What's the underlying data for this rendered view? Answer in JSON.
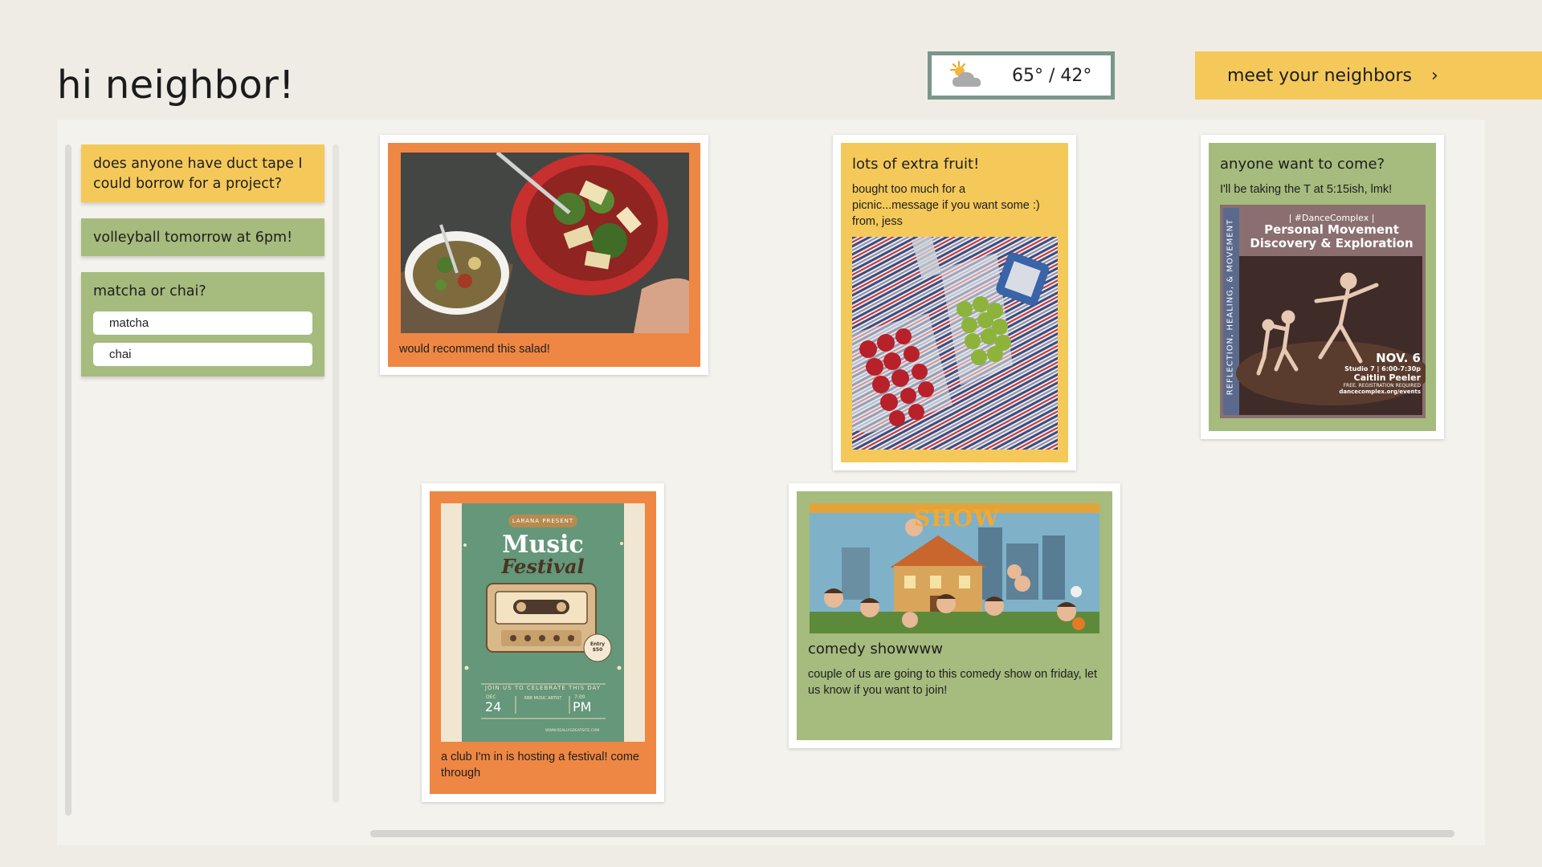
{
  "header": {
    "title": "hi neighbor!",
    "weather": {
      "icon": "partly-cloudy-icon",
      "temps": "65° / 42°"
    },
    "neighbors_button": {
      "label": "meet your neighbors",
      "icon": "chevron-right-icon"
    }
  },
  "sidebar": {
    "notes": [
      {
        "text": "does anyone have duct tape I could borrow for a project?",
        "color": "#f4c95a"
      },
      {
        "text": "volleyball tomorrow at 6pm!",
        "color": "#a6bb7e"
      }
    ],
    "poll": {
      "question": "matcha or chai?",
      "options": [
        "matcha",
        "chai"
      ],
      "color": "#a6bb7e"
    }
  },
  "posts": {
    "salad": {
      "caption": "would recommend this salad!",
      "color": "#ee8743"
    },
    "fruit": {
      "title": "lots of extra fruit!",
      "body": "bought too much for a picnic...message if you want some :) from, jess",
      "color": "#f4c95a"
    },
    "dance": {
      "title": "anyone want to come?",
      "body": "I'll be taking the T at 5:15ish, lmk!",
      "color": "#a6bb7e",
      "poster": {
        "org": "| #DanceComplex |",
        "headline1": "Personal Movement",
        "headline2": "Discovery & Exploration",
        "side_text": "REFLECTION, HEALING, & MOVEMENT",
        "date": "NOV. 6",
        "time": "Studio 7 | 6:00-7:30p",
        "instructor": "Caitlin Peeler",
        "note": "FREE. REGISTRATION REQUIRED",
        "site": "dancecomplex.org/events"
      }
    },
    "festival": {
      "caption": "a club I'm in is hosting a festival! come through",
      "color": "#ee8743",
      "poster": {
        "presenter": "LARANA PRESENT",
        "headline1": "Music",
        "headline2": "Festival",
        "entry": "Entry $50",
        "tagline": "JOIN US TO CELEBRATE THIS DAY",
        "month": "DEC",
        "day": "24",
        "time_label": "7:00",
        "ampm": "PM",
        "artist": "RBB MUSIC ARTIST",
        "site": "WWW.REALLYGREATSITE.COM"
      }
    },
    "comedy": {
      "title": "comedy showwww",
      "body": "couple of us are going to this comedy show on friday, let us know if you want to join!",
      "color": "#a6bb7e",
      "poster": {
        "show_word": "SHOW"
      }
    }
  }
}
